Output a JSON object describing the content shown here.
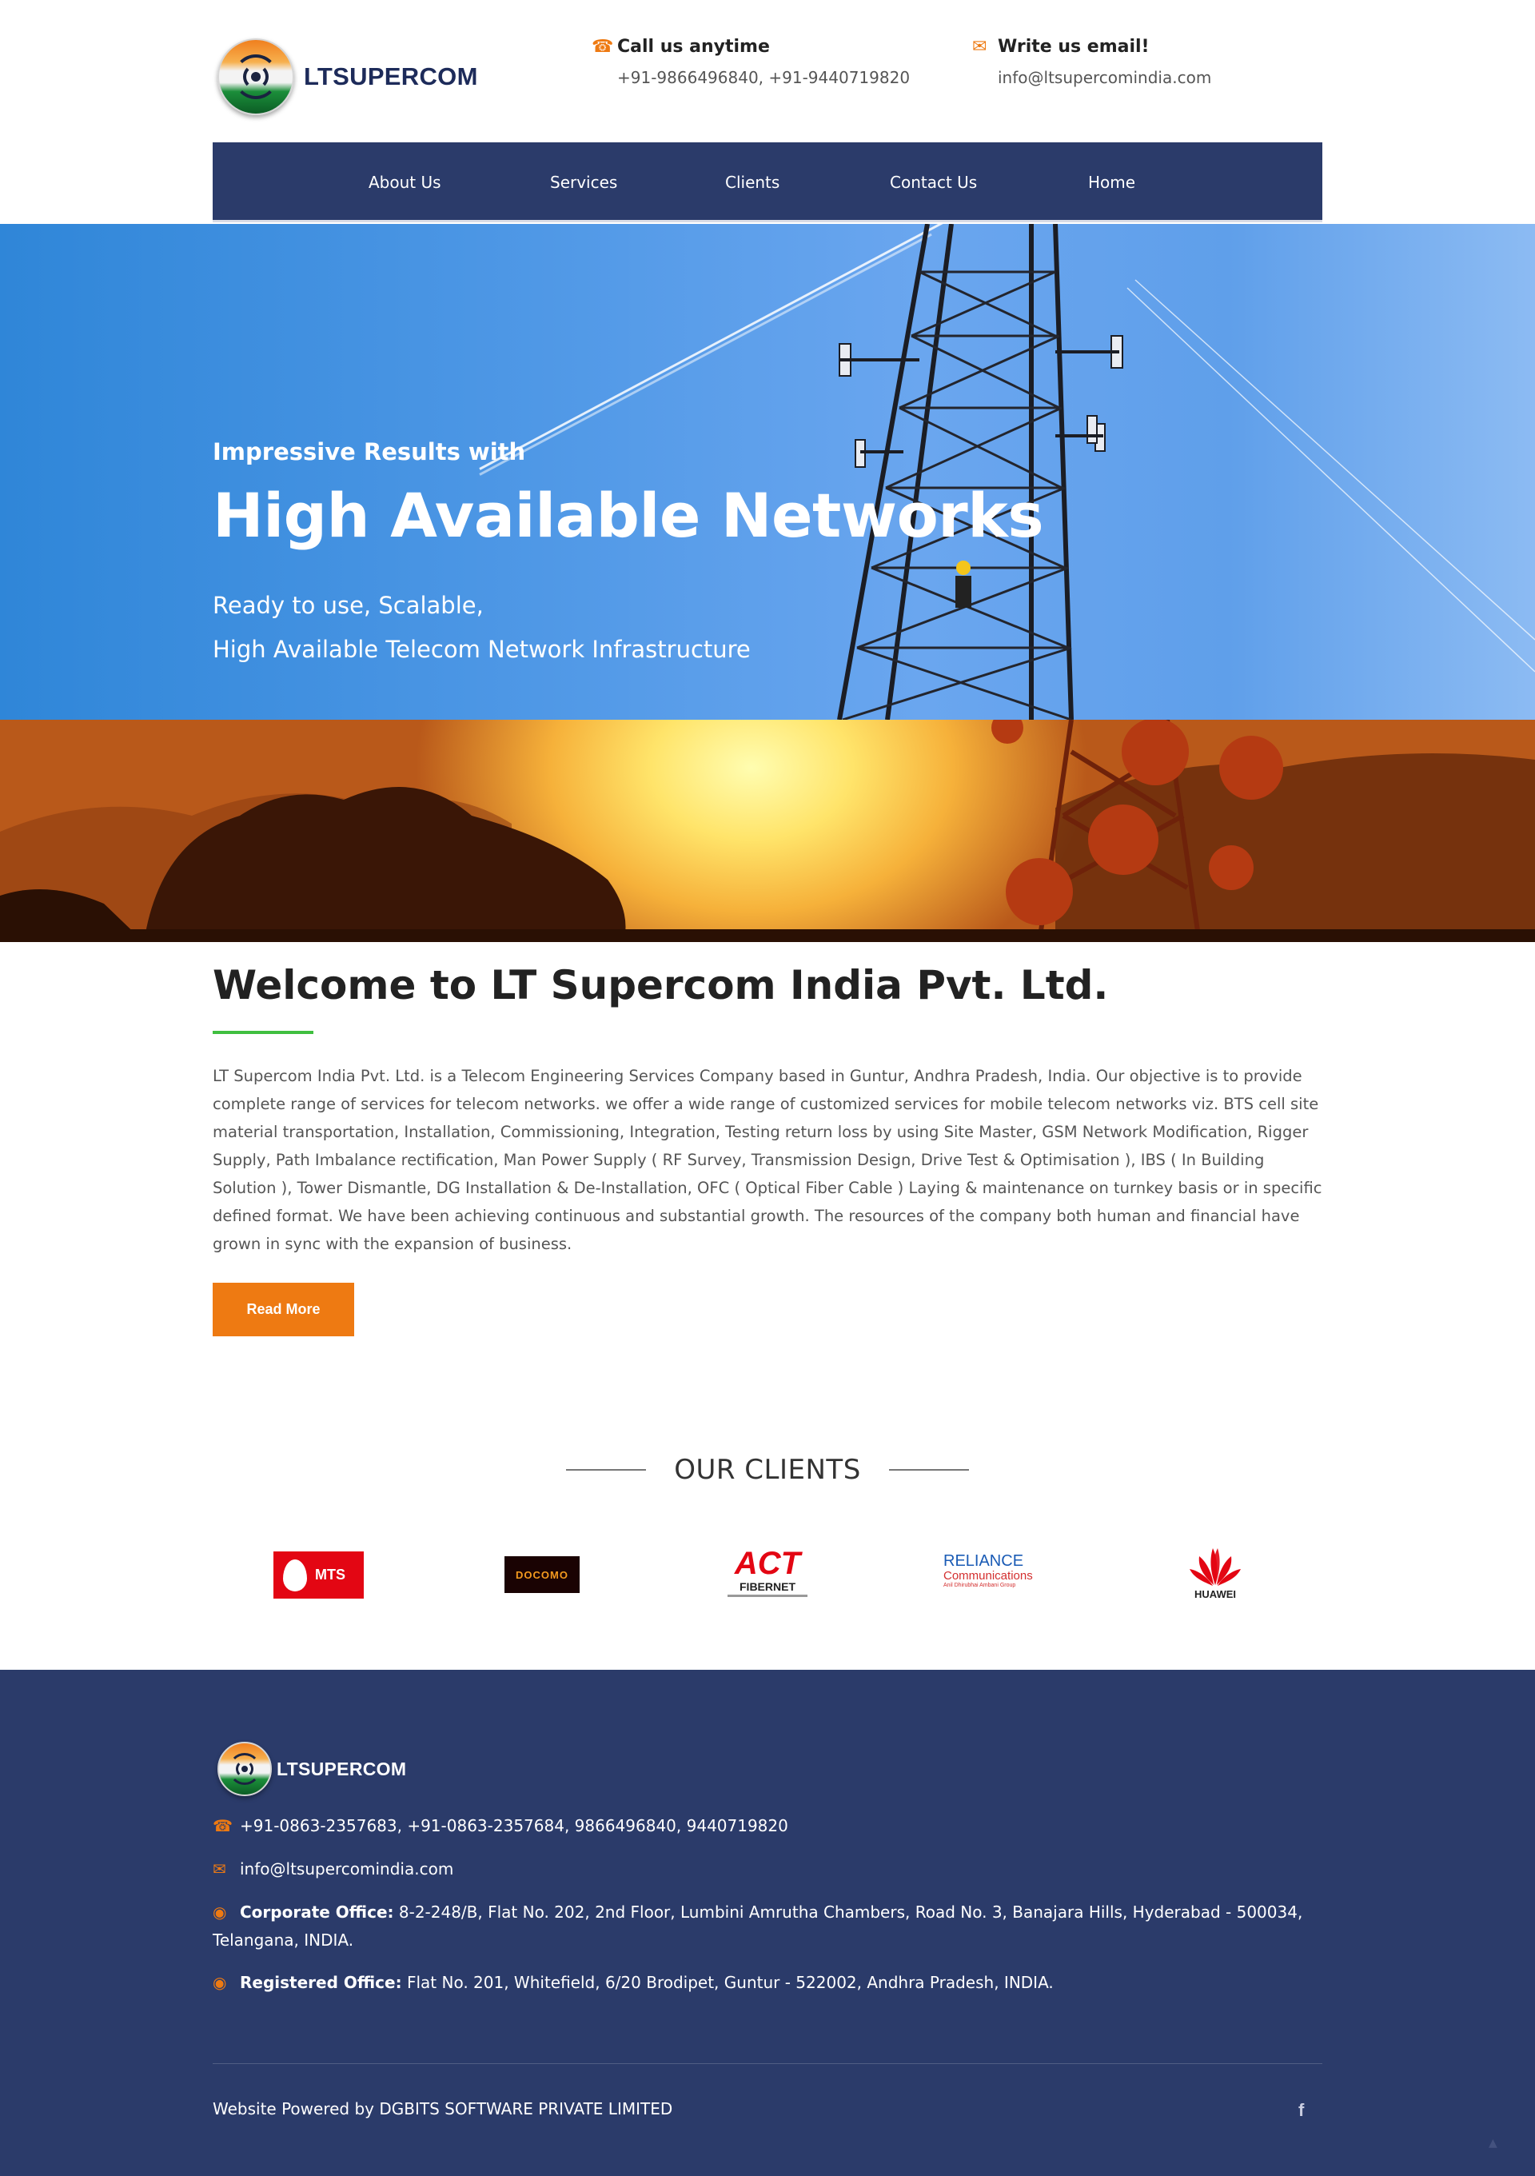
{
  "header": {
    "logo_text": "LTSUPERCOM",
    "phone": {
      "icon": "phone-icon",
      "heading": "Call us anytime",
      "value": "+91-9866496840, +91-9440719820"
    },
    "email": {
      "icon": "envelope-icon",
      "heading": "Write us email!",
      "value": "info@ltsupercomindia.com"
    }
  },
  "nav": {
    "items": [
      {
        "label": "About Us"
      },
      {
        "label": "Services"
      },
      {
        "label": "Clients"
      },
      {
        "label": "Contact Us"
      },
      {
        "label": "Home"
      }
    ]
  },
  "hero": {
    "subtitle": "Impressive Results with",
    "title": "High Available Networks",
    "line1": "Ready to use, Scalable,",
    "line2": "High Available Telecom Network Infrastructure"
  },
  "welcome": {
    "title": "Welcome to LT Supercom India Pvt. Ltd.",
    "body": "LT Supercom India Pvt. Ltd. is a Telecom Engineering Services Company based in Guntur, Andhra Pradesh, India. Our objective is to provide complete range of services for telecom networks. we offer a wide range of customized services for mobile telecom networks viz. BTS cell site material transportation, Installation, Commissioning, Integration, Testing return loss by using Site Master, GSM Network Modification, Rigger Supply, Path Imbalance rectification, Man Power Supply ( RF Survey, Transmission Design, Drive Test & Optimisation ), IBS ( In Building Solution ), Tower Dismantle, DG Installation & De-Installation, OFC ( Optical Fiber Cable ) Laying & maintenance on turnkey basis or in specific defined format. We have been achieving continuous and substantial growth. The resources of the company both human and financial have grown in sync with the expansion of business.",
    "button": "Read More"
  },
  "clients": {
    "heading": "OUR CLIENTS",
    "logos": {
      "mts": "MTS",
      "docomo": "DOCOMO",
      "act_1": "ACT",
      "act_2": "FIBERNET",
      "reliance_1": "RELIANCE",
      "reliance_2": "Communications",
      "reliance_3": "Anil Dhirubhai Ambani Group",
      "huawei": "HUAWEI"
    }
  },
  "footer": {
    "logo_text": "LTSUPERCOM",
    "phone": "+91-0863-2357683, +91-0863-2357684, 9866496840, 9440719820",
    "email": "info@ltsupercomindia.com",
    "corporate_label": "Corporate Office:",
    "corporate_address": "8-2-248/B, Flat No. 202, 2nd Floor, Lumbini Amrutha Chambers, Road No. 3, Banajara Hills, Hyderabad - 500034, Telangana, INDIA.",
    "registered_label": "Registered Office:",
    "registered_address": "Flat No. 201, Whitefield, 6/20 Brodipet, Guntur - 522002, Andhra Pradesh, INDIA.",
    "powered_by": "Website Powered by DGBITS SOFTWARE PRIVATE LIMITED",
    "social_icon": "facebook-icon",
    "scroll_icon": "scroll-up-icon"
  },
  "colors": {
    "navy": "#2b3b6a",
    "accent_orange": "#ee7a12",
    "green_rule": "#3fbf3f"
  }
}
